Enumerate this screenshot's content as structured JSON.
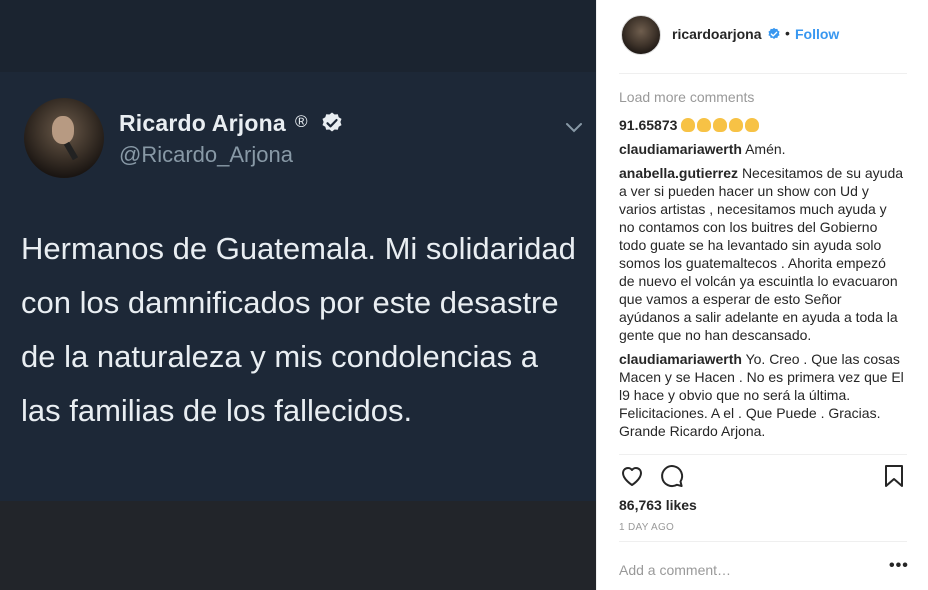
{
  "tweet": {
    "name": "Ricardo Arjona",
    "registered": "®",
    "handle": "@Ricardo_Arjona",
    "text": "Hermanos de Guatemala. Mi solidaridad con los damnificados por este desastre de la naturaleza y mis condolencias a las familias de los fallecidos."
  },
  "header": {
    "username": "ricardoarjona",
    "dot": "•",
    "follow_label": "Follow"
  },
  "comments": {
    "load_more": "Load more comments",
    "items": [
      {
        "user": "91.65873",
        "text": "",
        "emoji_count": 5
      },
      {
        "user": "claudiamariawerth",
        "text": "Amén."
      },
      {
        "user": "anabella.gutierrez",
        "text": "Necesitamos de su ayuda a ver si pueden hacer un show con Ud y varios artistas , necesitamos much ayuda y no contamos con los buitres del Gobierno todo guate se ha levantado sin ayuda solo somos los guatemaltecos . Ahorita empezó de nuevo el volcán ya escuintla lo evacuaron que vamos a esperar de esto Señor ayúdanos a salir adelante en ayuda a toda la gente que no han descansado."
      },
      {
        "user": "claudiamariawerth",
        "text": "Yo. Creo . Que las cosas Macen y se Hacen . No es primera vez que El l9 hace y obvio que no será la última. Felicitaciones. A el . Que Puede . Gracias. Grande Ricardo Arjona."
      }
    ]
  },
  "actions": {
    "likes": "86,763 likes",
    "time_ago": "1 DAY AGO"
  },
  "add_comment": {
    "placeholder": "Add a comment…",
    "more": "•••"
  },
  "colors": {
    "accent": "#3897f0",
    "tweet_bg": "#1d2837",
    "text_dark": "#262626",
    "muted": "#999999"
  }
}
